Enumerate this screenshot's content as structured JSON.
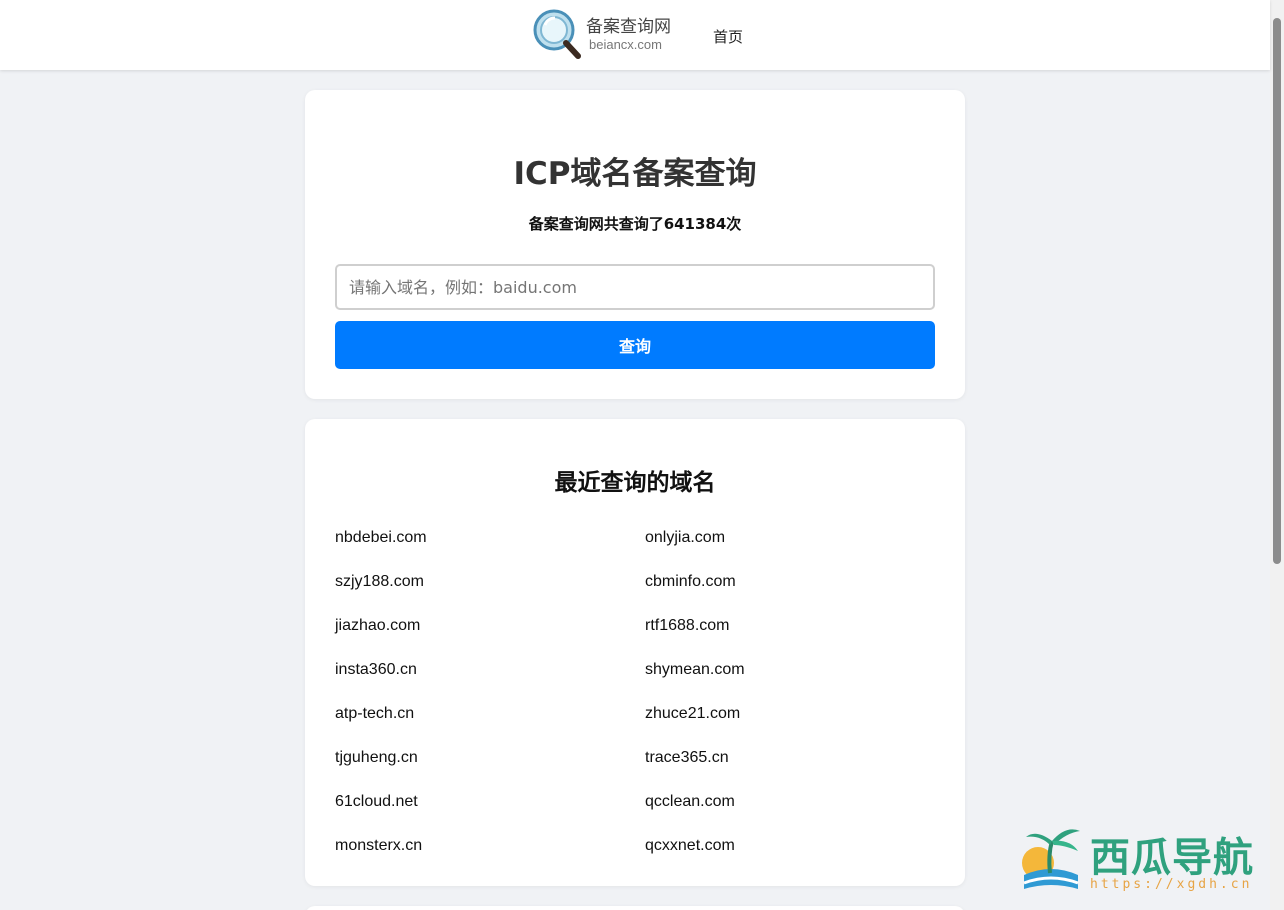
{
  "header": {
    "logo_title": "备案查询网",
    "logo_subtitle": "beiancx.com",
    "nav_home": "首页"
  },
  "search": {
    "title": "ICP域名备案查询",
    "count_text": "备案查询网共查询了641384次",
    "placeholder": "请输入域名，例如：baidu.com",
    "value": "",
    "button_label": "查询"
  },
  "recent": {
    "title": "最近查询的域名",
    "domains": [
      "nbdebei.com",
      "onlyjia.com",
      "szjy188.com",
      "cbminfo.com",
      "jiazhao.com",
      "rtf1688.com",
      "insta360.cn",
      "shymean.com",
      "atp-tech.cn",
      "zhuce21.com",
      "tjguheng.cn",
      "trace365.cn",
      "61cloud.net",
      "qcclean.com",
      "monsterx.cn",
      "qcxxnet.com"
    ]
  },
  "watermark": {
    "title": "西瓜导航",
    "url": "https://xgdh.cn"
  },
  "colors": {
    "primary": "#007bff",
    "page_background": "#f0f2f5",
    "card_background": "#ffffff",
    "watermark_green": "#2fa17e",
    "watermark_orange": "#e7a445"
  }
}
